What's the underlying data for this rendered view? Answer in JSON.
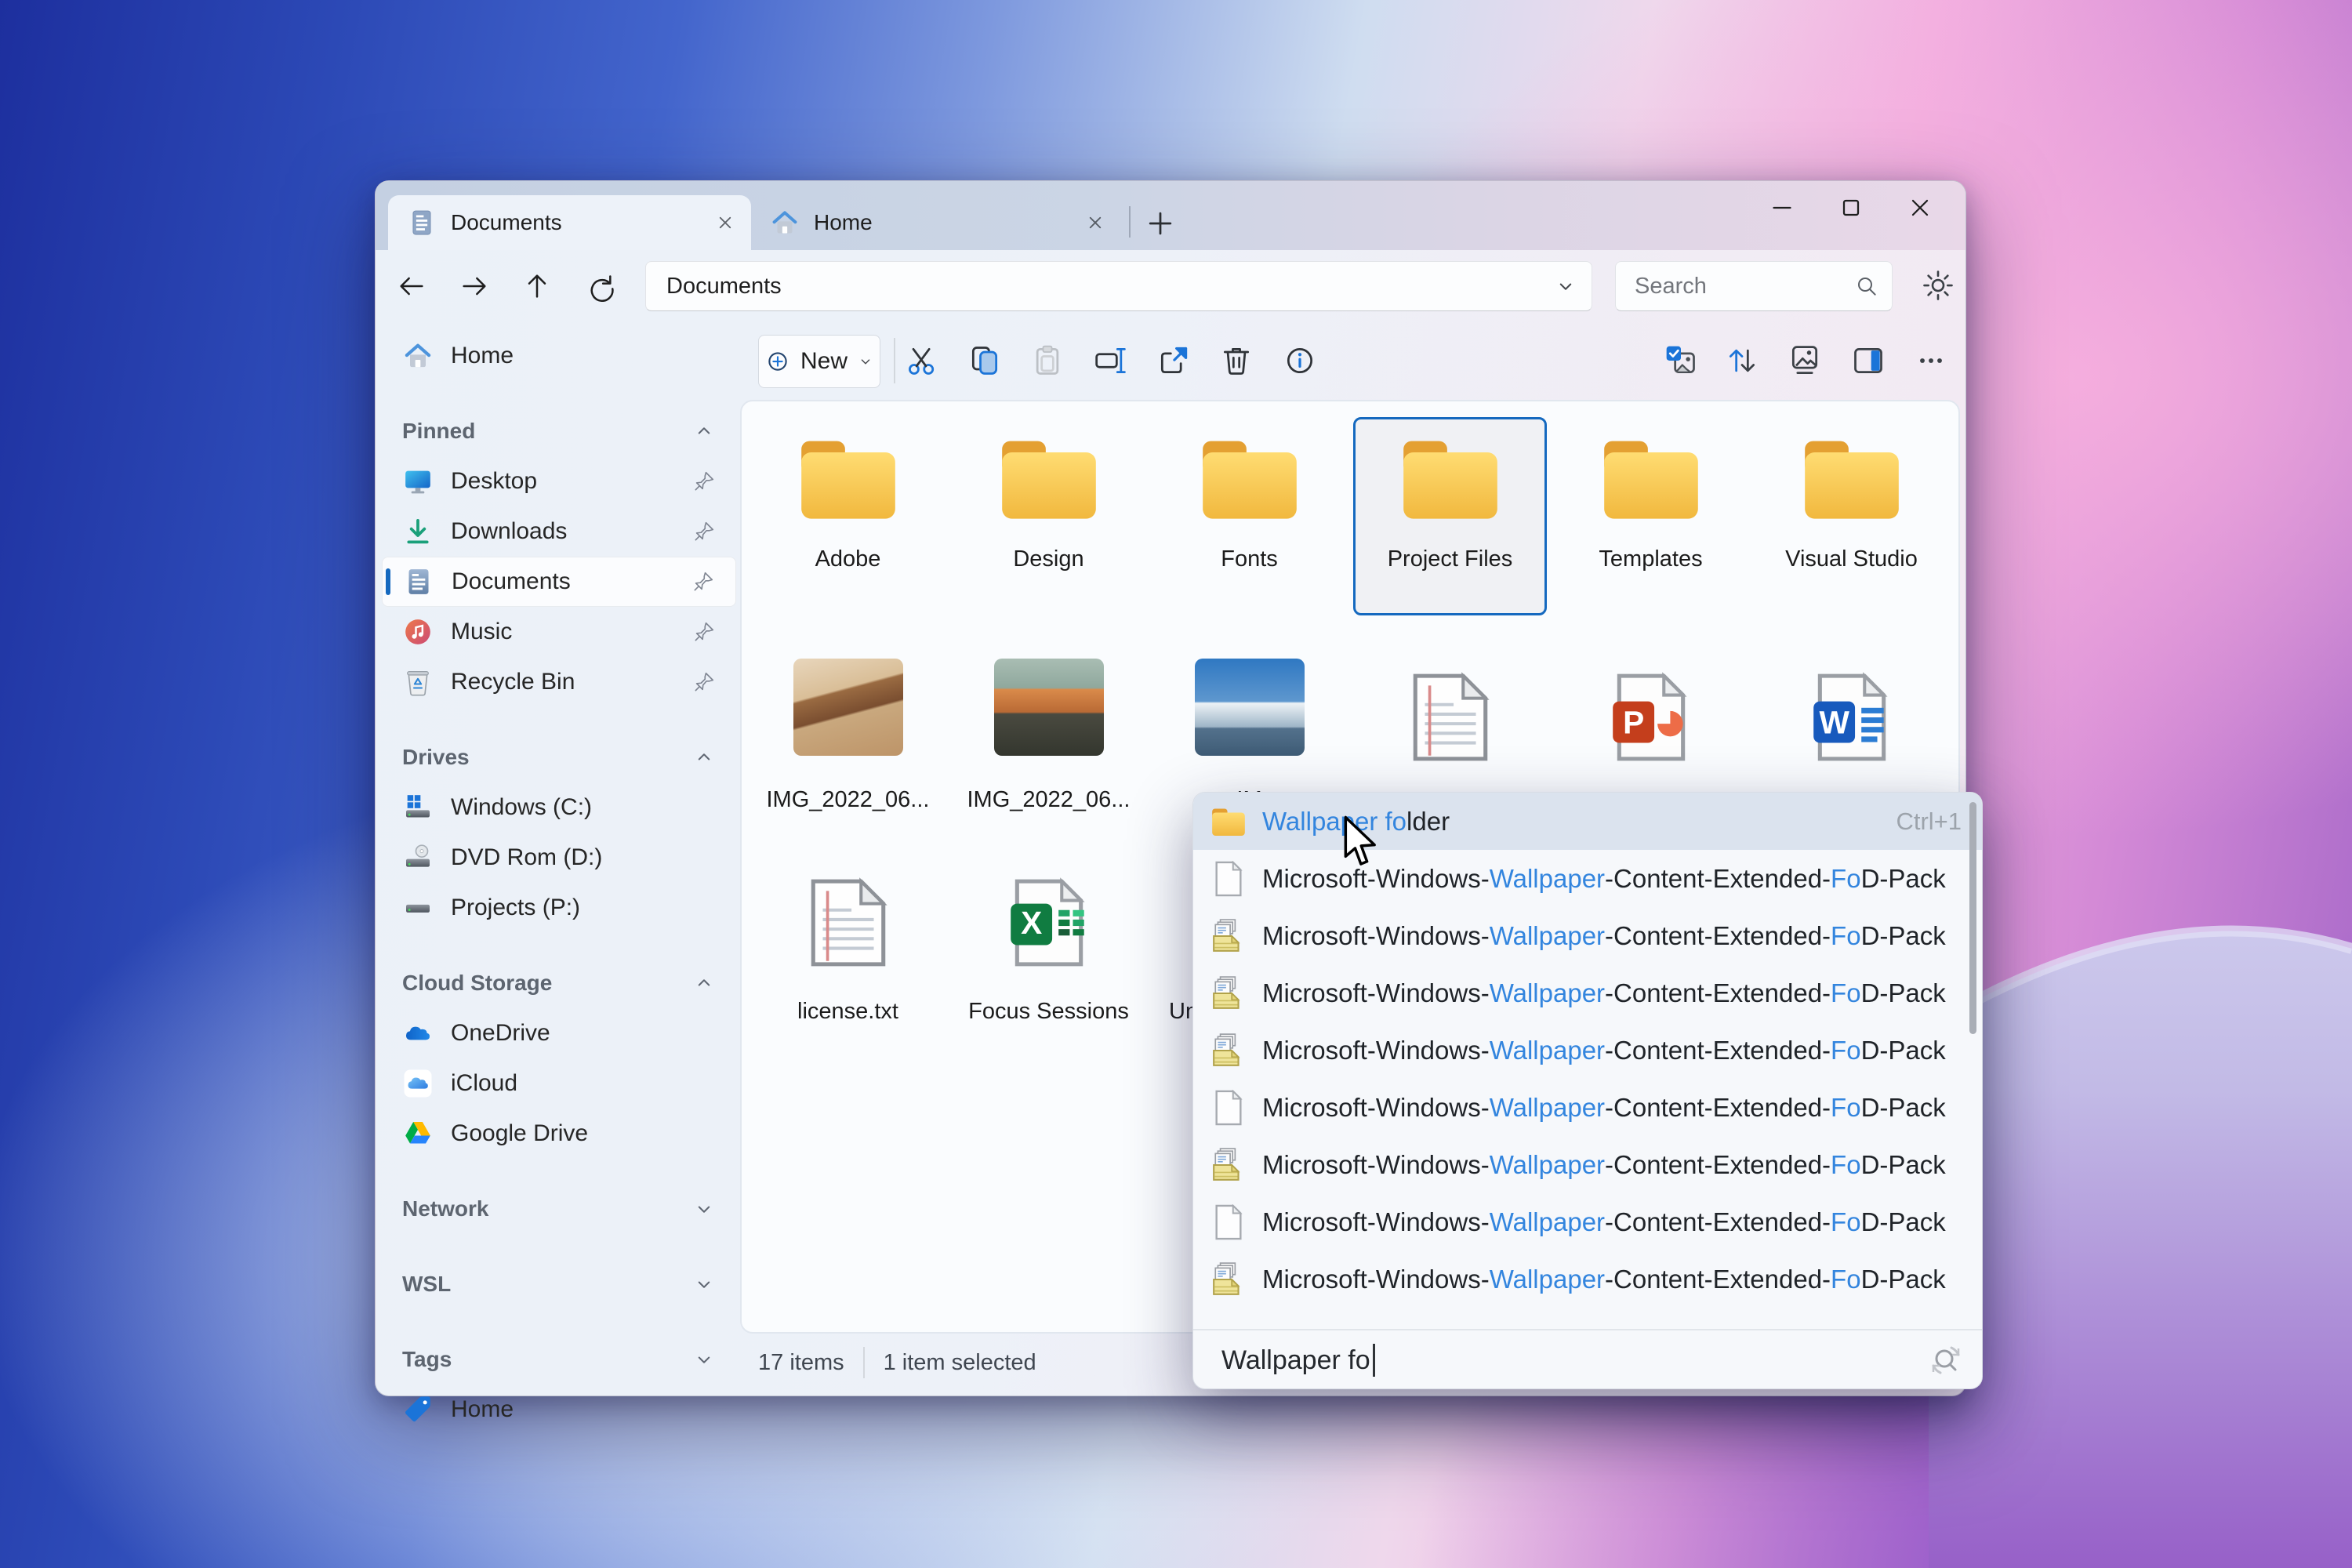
{
  "colors": {
    "accent": "#1569BF",
    "match_blue": "#3385DE",
    "folder_yellow": "#F5C64A"
  },
  "titlebar": {
    "tabs": [
      {
        "label": "Documents",
        "icon": "doc-tab",
        "active": true
      },
      {
        "label": "Home",
        "icon": "home-tab",
        "active": false
      }
    ]
  },
  "navigation": {
    "address": "Documents",
    "search_placeholder": "Search"
  },
  "toolbar": {
    "new_label": "New"
  },
  "sidebar": {
    "items": [
      {
        "kind": "item",
        "label": "Home",
        "icon": "home"
      },
      {
        "kind": "header",
        "label": "Pinned",
        "chevron": "chev-up"
      },
      {
        "kind": "item",
        "label": "Desktop",
        "icon": "desktop",
        "pinned": true
      },
      {
        "kind": "item",
        "label": "Downloads",
        "icon": "downloads",
        "pinned": true
      },
      {
        "kind": "item",
        "label": "Documents",
        "icon": "documents",
        "pinned": true,
        "selected": true
      },
      {
        "kind": "item",
        "label": "Music",
        "icon": "music",
        "pinned": true
      },
      {
        "kind": "item",
        "label": "Recycle Bin",
        "icon": "recycle",
        "pinned": true
      },
      {
        "kind": "header",
        "label": "Drives",
        "chevron": "chev-up"
      },
      {
        "kind": "item",
        "label": "Windows (C:)",
        "icon": "drive-windows"
      },
      {
        "kind": "item",
        "label": "DVD Rom (D:)",
        "icon": "drive-dvd"
      },
      {
        "kind": "item",
        "label": "Projects (P:)",
        "icon": "drive"
      },
      {
        "kind": "header",
        "label": "Cloud Storage",
        "chevron": "chev-up"
      },
      {
        "kind": "item",
        "label": "OneDrive",
        "icon": "onedrive"
      },
      {
        "kind": "item",
        "label": "iCloud",
        "icon": "icloud"
      },
      {
        "kind": "item",
        "label": "Google Drive",
        "icon": "gdrive"
      },
      {
        "kind": "header",
        "label": "Network",
        "chevron": "chev-down"
      },
      {
        "kind": "header",
        "label": "WSL",
        "chevron": "chev-down"
      },
      {
        "kind": "header",
        "label": "Tags",
        "chevron": "chev-down"
      },
      {
        "kind": "item",
        "label": "Home",
        "icon": "tag"
      }
    ]
  },
  "files": {
    "row1": [
      {
        "label": "Adobe",
        "type": "folder",
        "icon": "folder"
      },
      {
        "label": "Design",
        "type": "folder",
        "icon": "folder"
      },
      {
        "label": "Fonts",
        "type": "folder",
        "icon": "folder"
      },
      {
        "label": "Project Files",
        "type": "folder",
        "icon": "folder",
        "selected": true
      },
      {
        "label": "Templates",
        "type": "folder",
        "icon": "folder"
      },
      {
        "label": "Visual Studio",
        "type": "folder",
        "icon": "folder"
      }
    ],
    "row2": [
      {
        "label": "IMG_2022_06...",
        "type": "image",
        "variant": "desert"
      },
      {
        "label": "IMG_2022_06...",
        "type": "image",
        "variant": "sunset"
      },
      {
        "label": "IM",
        "type": "image",
        "variant": "alps"
      },
      {
        "label": "",
        "type": "doc",
        "icon": "txtdoc"
      },
      {
        "label": "",
        "type": "doc",
        "icon": "ppt"
      },
      {
        "label": "",
        "type": "doc",
        "icon": "word"
      }
    ],
    "row3": [
      {
        "label": "license.txt",
        "type": "doc",
        "icon": "txtdoc"
      },
      {
        "label": "Focus Sessions",
        "type": "doc",
        "icon": "excel"
      },
      {
        "label": "Un",
        "type": "clipped",
        "icon": "txtdoc"
      }
    ]
  },
  "statusbar": {
    "count": "17 items",
    "selected": "1 item selected"
  },
  "popup": {
    "rows": [
      {
        "icon": "folder",
        "active": true,
        "shortcut": "Ctrl+1",
        "parts": [
          {
            "t": "Wallpaper fo",
            "hl": true
          },
          {
            "t": "lder"
          }
        ]
      },
      {
        "icon": "file",
        "parts": [
          {
            "t": "Microsoft-Windows-"
          },
          {
            "t": "Wallpaper",
            "hl": true
          },
          {
            "t": "-Content-Extended-"
          },
          {
            "t": "Fo",
            "hl": true
          },
          {
            "t": "D-Pack"
          }
        ]
      },
      {
        "icon": "cab",
        "parts": [
          {
            "t": "Microsoft-Windows-"
          },
          {
            "t": "Wallpaper",
            "hl": true
          },
          {
            "t": "-Content-Extended-"
          },
          {
            "t": "Fo",
            "hl": true
          },
          {
            "t": "D-Pack"
          }
        ]
      },
      {
        "icon": "cab",
        "parts": [
          {
            "t": "Microsoft-Windows-"
          },
          {
            "t": "Wallpaper",
            "hl": true
          },
          {
            "t": "-Content-Extended-"
          },
          {
            "t": "Fo",
            "hl": true
          },
          {
            "t": "D-Pack"
          }
        ]
      },
      {
        "icon": "cab",
        "parts": [
          {
            "t": "Microsoft-Windows-"
          },
          {
            "t": "Wallpaper",
            "hl": true
          },
          {
            "t": "-Content-Extended-"
          },
          {
            "t": "Fo",
            "hl": true
          },
          {
            "t": "D-Pack"
          }
        ]
      },
      {
        "icon": "file",
        "parts": [
          {
            "t": "Microsoft-Windows-"
          },
          {
            "t": "Wallpaper",
            "hl": true
          },
          {
            "t": "-Content-Extended-"
          },
          {
            "t": "Fo",
            "hl": true
          },
          {
            "t": "D-Pack"
          }
        ]
      },
      {
        "icon": "cab",
        "parts": [
          {
            "t": "Microsoft-Windows-"
          },
          {
            "t": "Wallpaper",
            "hl": true
          },
          {
            "t": "-Content-Extended-"
          },
          {
            "t": "Fo",
            "hl": true
          },
          {
            "t": "D-Pack"
          }
        ]
      },
      {
        "icon": "file",
        "parts": [
          {
            "t": "Microsoft-Windows-"
          },
          {
            "t": "Wallpaper",
            "hl": true
          },
          {
            "t": "-Content-Extended-"
          },
          {
            "t": "Fo",
            "hl": true
          },
          {
            "t": "D-Pack"
          }
        ]
      },
      {
        "icon": "cab",
        "parts": [
          {
            "t": "Microsoft-Windows-"
          },
          {
            "t": "Wallpaper",
            "hl": true
          },
          {
            "t": "-Content-Extended-"
          },
          {
            "t": "Fo",
            "hl": true
          },
          {
            "t": "D-Pack"
          }
        ]
      }
    ],
    "query": "Wallpaper fo"
  }
}
